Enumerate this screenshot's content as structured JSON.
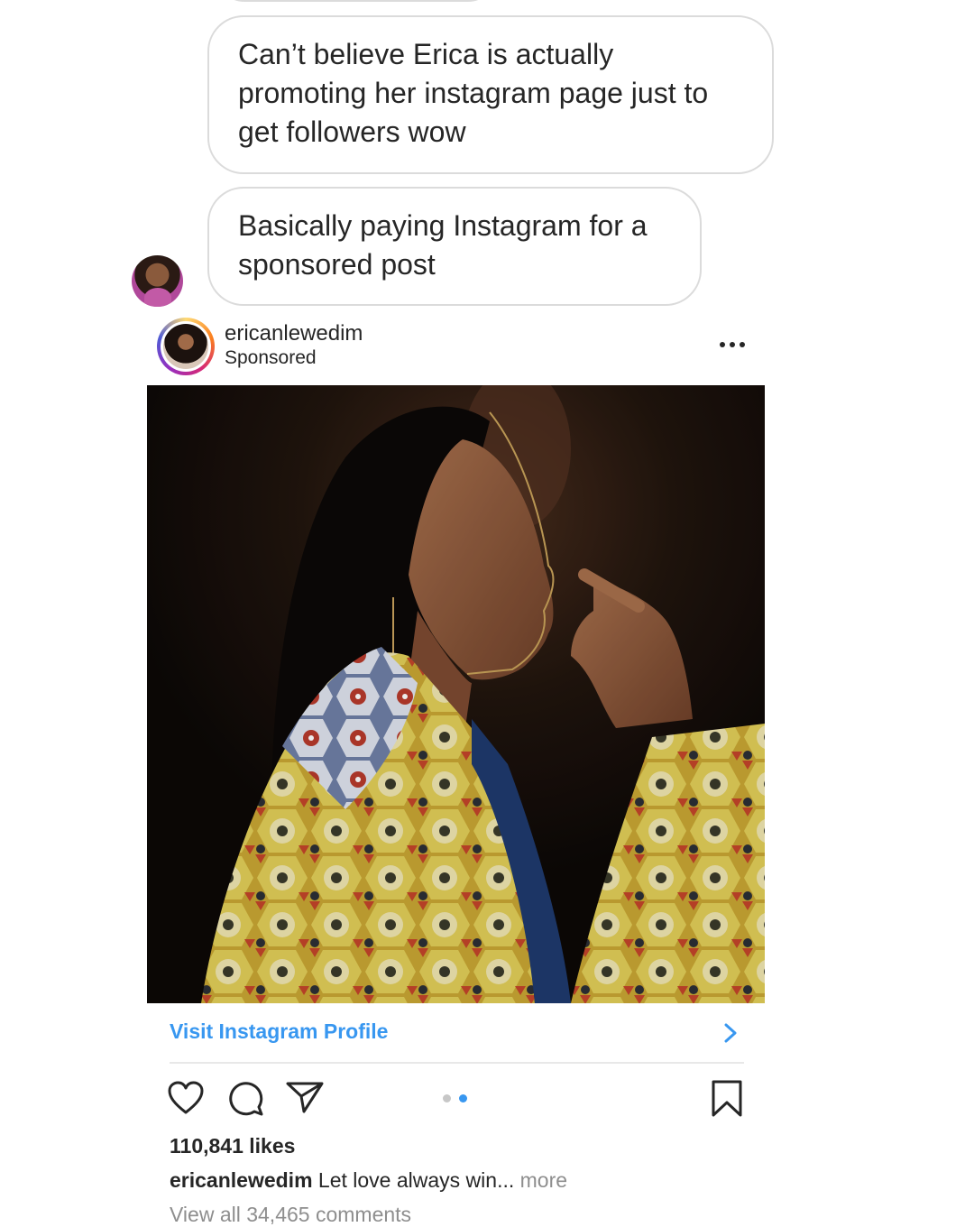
{
  "messages": [
    {
      "text": "Can’t believe Erica is actually promoting her instagram page just to get followers wow"
    },
    {
      "text": "Basically paying Instagram for a sponsored post"
    }
  ],
  "post": {
    "username": "ericanlewedim",
    "sponsored_label": "Sponsored",
    "cta_label": "Visit Instagram Profile",
    "carousel": {
      "count": 2,
      "active_index": 1
    },
    "likes": "110,841 likes",
    "caption_user": "ericanlewedim",
    "caption_text": "Let love always win...",
    "caption_more": "more",
    "comments_link": "View all 34,465 comments"
  },
  "colors": {
    "link_blue": "#3897f0",
    "text": "#262626",
    "muted": "#8e8e8e",
    "bubble_border": "#dbdbdb"
  },
  "icons": [
    "more-options-icon",
    "chevron-right-icon",
    "heart-icon",
    "comment-icon",
    "share-icon",
    "bookmark-icon"
  ]
}
